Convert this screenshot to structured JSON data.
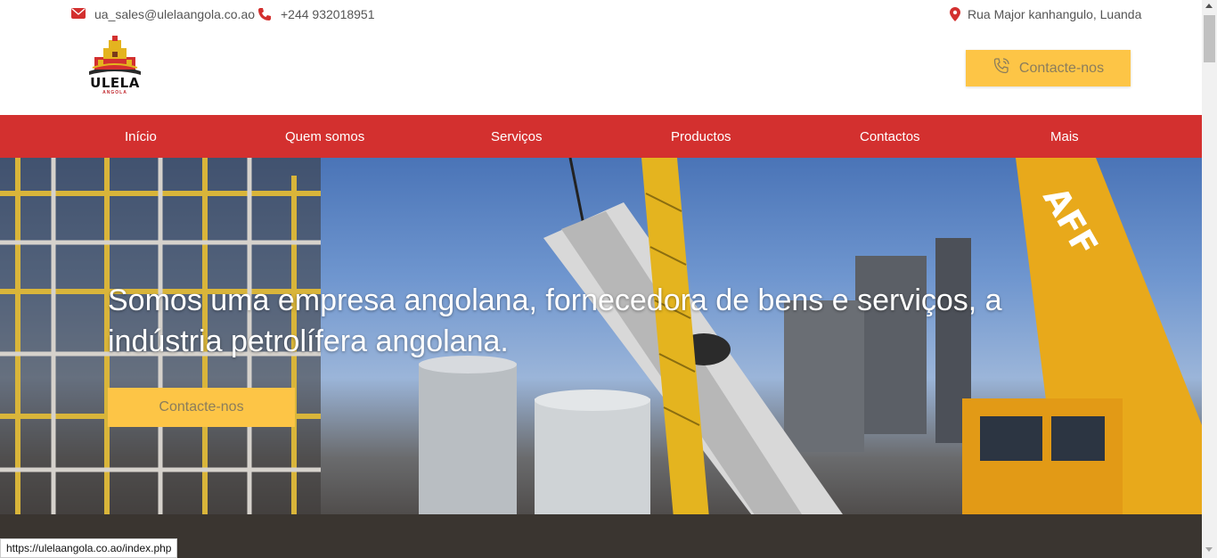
{
  "topbar": {
    "email": "ua_sales@ulelaangola.co.ao",
    "phone": "+244 932018951",
    "address": "Rua Major kanhangulo, Luanda"
  },
  "header": {
    "logo_text": "ULELA",
    "logo_sub": "ANGOLA",
    "cta_label": "Contacte-nos"
  },
  "nav": {
    "items": [
      {
        "label": "Início"
      },
      {
        "label": "Quem somos"
      },
      {
        "label": "Serviços"
      },
      {
        "label": "Productos"
      },
      {
        "label": "Contactos"
      },
      {
        "label": "Mais"
      }
    ]
  },
  "hero": {
    "title": "Somos uma empresa angolana, fornecedora de bens e serviços, a indústria petrolífera angolana.",
    "cta_label": "Contacte-nos",
    "crane_text": "AFF"
  },
  "status": {
    "url": "https://ulelaangola.co.ao/index.php"
  },
  "colors": {
    "brand_red": "#d3302f",
    "accent_yellow": "#fdc546"
  },
  "icons": [
    "envelope-icon",
    "phone-icon",
    "map-marker-icon",
    "phone-call-icon"
  ]
}
